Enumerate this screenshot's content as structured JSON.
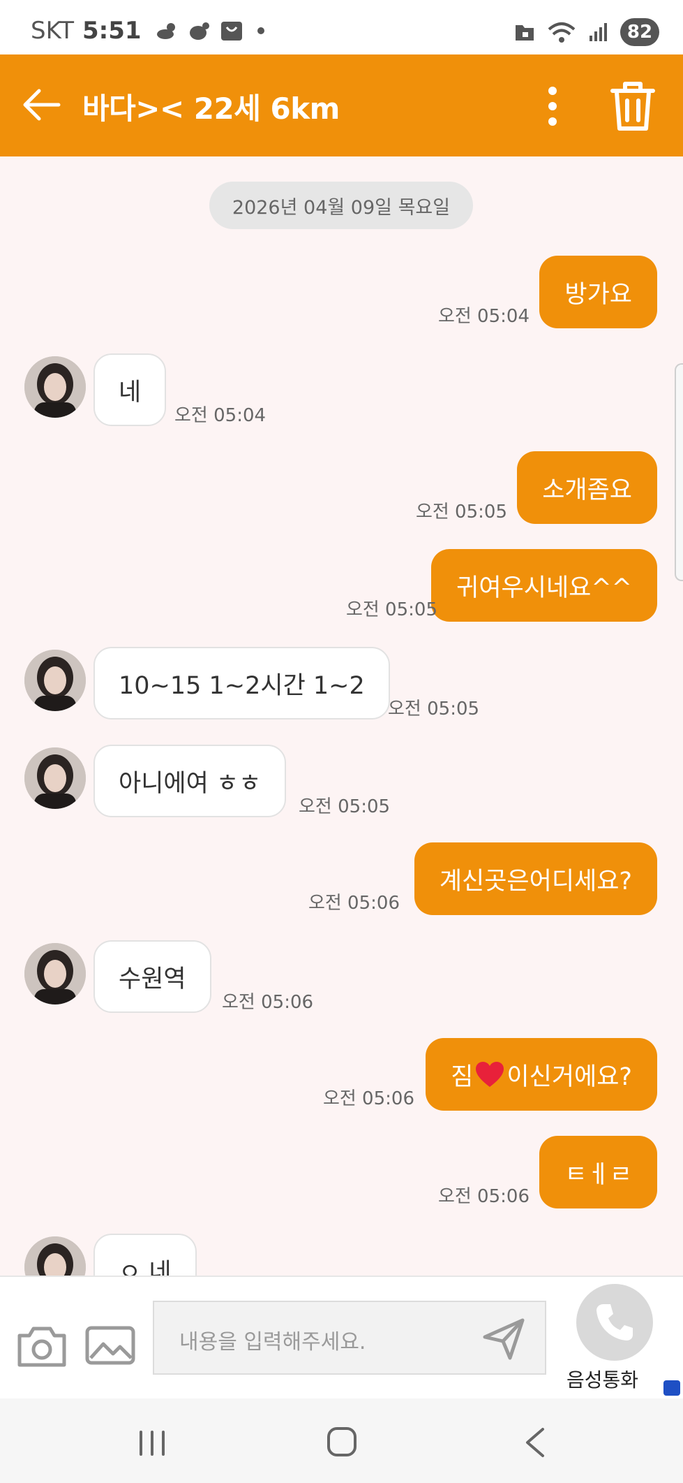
{
  "status_bar": {
    "carrier": "SKT",
    "time": "5:51",
    "battery": "82",
    "wifi_label": "6"
  },
  "header": {
    "title": "바다>< 22세 6km"
  },
  "chat": {
    "date": "2026년 04월 09일 목요일",
    "messages": [
      {
        "side": "out",
        "text": "방가요",
        "time": "오전 05:04"
      },
      {
        "side": "in",
        "text": "네",
        "time": "오전 05:04"
      },
      {
        "side": "out",
        "text": "소개좀요",
        "time": "오전 05:05"
      },
      {
        "side": "out",
        "text": "귀여우시네요^^",
        "time": "오전 05:05"
      },
      {
        "side": "in",
        "text": "10~15 1~2시간 1~2",
        "time": "오전 05:05"
      },
      {
        "side": "in",
        "text": "아니에여 ㅎㅎ",
        "time": "오전 05:05"
      },
      {
        "side": "out",
        "text": "계신곳은어디세요?",
        "time": "오전 05:06"
      },
      {
        "side": "in",
        "text": "수원역",
        "time": "오전 05:06"
      },
      {
        "side": "out",
        "text_before": "짐",
        "text_after": "이신거에요?",
        "emoji": "red-heart",
        "time": "오전 05:06"
      },
      {
        "side": "out",
        "text": "ㅌㅔㄹ",
        "time": "오전 05:06"
      },
      {
        "side": "in",
        "text": "ㅇ 네",
        "time": ""
      }
    ]
  },
  "input": {
    "placeholder": "내용을 입력해주세요.",
    "call_label": "음성통화"
  },
  "colors": {
    "accent": "#f0900a",
    "chat_bg": "#fdf4f4"
  }
}
